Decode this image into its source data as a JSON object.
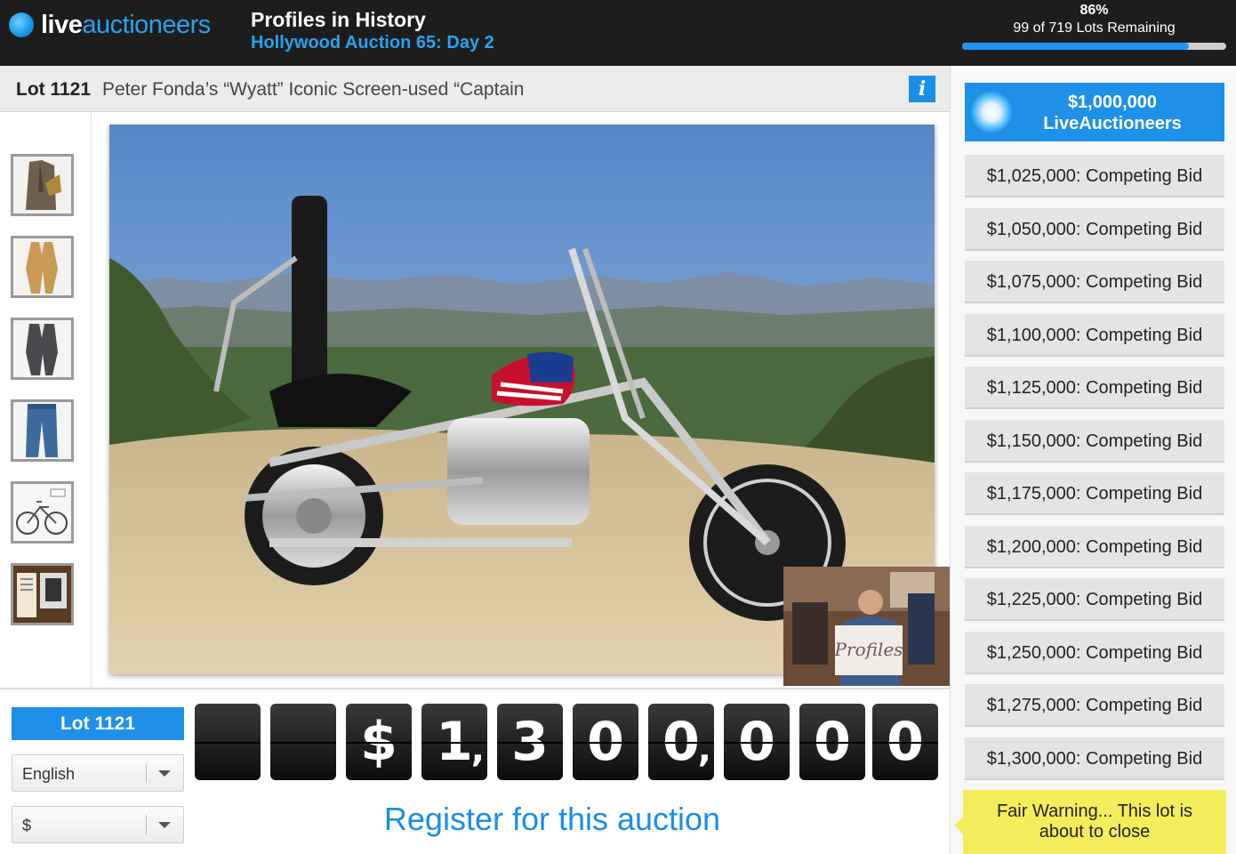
{
  "header": {
    "logo_live": "live",
    "logo_auctioneers": "auctioneers",
    "auction_house": "Profiles in History",
    "auction_name": "Hollywood Auction 65: Day 2",
    "progress_percent": "86%",
    "progress_fraction": 0.86,
    "lots_remaining": "99 of 719 Lots Remaining"
  },
  "lot": {
    "number_label": "Lot 1121",
    "title": "Peter Fonda’s “Wyatt” Iconic Screen-used “Captain",
    "info_icon": "info-icon",
    "info_label": "i"
  },
  "thumbnails": [
    {
      "name": "thumb-suit-jacket"
    },
    {
      "name": "thumb-tan-suit"
    },
    {
      "name": "thumb-grey-suit"
    },
    {
      "name": "thumb-jeans"
    },
    {
      "name": "thumb-bicycle"
    },
    {
      "name": "thumb-document"
    }
  ],
  "bidding": {
    "leading_amount": "$1,000,000",
    "leading_bidder": "LiveAuctioneers",
    "competing": [
      "$1,025,000: Competing Bid",
      "$1,050,000: Competing Bid",
      "$1,075,000: Competing Bid",
      "$1,100,000: Competing Bid",
      "$1,125,000: Competing Bid",
      "$1,150,000: Competing Bid",
      "$1,175,000: Competing Bid",
      "$1,200,000: Competing Bid",
      "$1,225,000: Competing Bid",
      "$1,250,000: Competing Bid",
      "$1,275,000: Competing Bid",
      "$1,300,000: Competing Bid"
    ],
    "fair_warning_line1": "Fair Warning... This lot is",
    "fair_warning_line2": "about to close"
  },
  "controls": {
    "lot_badge": "Lot 1121",
    "language": "English",
    "currency": "$"
  },
  "price_display": [
    "",
    "",
    "$",
    "1",
    "3",
    "0",
    "0",
    "0",
    "0",
    "0"
  ],
  "register_label": "Register for this auction",
  "colors": {
    "accent": "#1e90e8",
    "header_bg": "#1d1d1d",
    "warning": "#f5ec5c"
  }
}
